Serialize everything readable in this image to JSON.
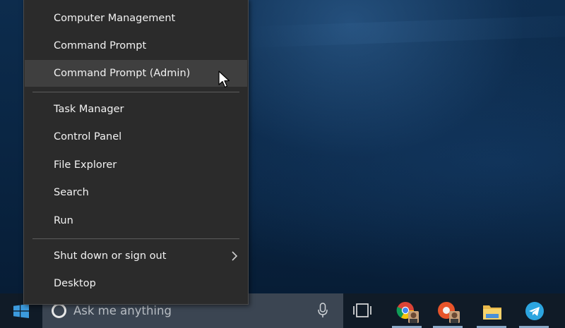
{
  "menu": {
    "items": [
      {
        "label": "Computer Management"
      },
      {
        "label": "Command Prompt"
      },
      {
        "label": "Command Prompt (Admin)"
      },
      {
        "label": "Task Manager"
      },
      {
        "label": "Control Panel"
      },
      {
        "label": "File Explorer"
      },
      {
        "label": "Search"
      },
      {
        "label": "Run"
      },
      {
        "label": "Shut down or sign out"
      },
      {
        "label": "Desktop"
      }
    ],
    "hovered_item": "Command Prompt (Admin)",
    "submenu_indicator": "chevron-right-icon"
  },
  "taskbar": {
    "search_placeholder": "Ask me anything",
    "apps": [
      {
        "name": "chrome-app",
        "icon": "chrome-icon"
      },
      {
        "name": "app-profile",
        "icon": "profile-icon"
      },
      {
        "name": "file-explorer-app",
        "icon": "folder-icon"
      },
      {
        "name": "telegram-app",
        "icon": "telegram-icon"
      }
    ]
  },
  "colors": {
    "menu_bg": "#2b2b2b",
    "menu_hover": "#3f3f3f",
    "taskbar_bg": "#101b27",
    "search_bg": "#3b4552",
    "windows_blue": "#3c9bde"
  }
}
